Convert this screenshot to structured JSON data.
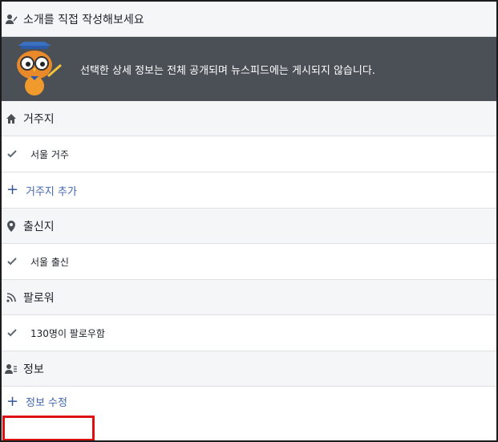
{
  "intro": {
    "title": "소개를 직접 작성해보세요"
  },
  "banner": {
    "text": "선택한 상세 정보는 전체 공개되며 뉴스피드에는 게시되지 않습니다."
  },
  "residence": {
    "title": "거주지",
    "value": "서울 거주",
    "add_label": "거주지 추가"
  },
  "hometown": {
    "title": "출신지",
    "value": "서울 출신"
  },
  "followers": {
    "title": "팔로워",
    "value": "130명이 팔로우함"
  },
  "info": {
    "title": "정보",
    "edit_label": "정보 수정"
  },
  "colors": {
    "link": "#4267b2",
    "highlight": "#dd1111",
    "banner_bg": "#4b4f56"
  }
}
